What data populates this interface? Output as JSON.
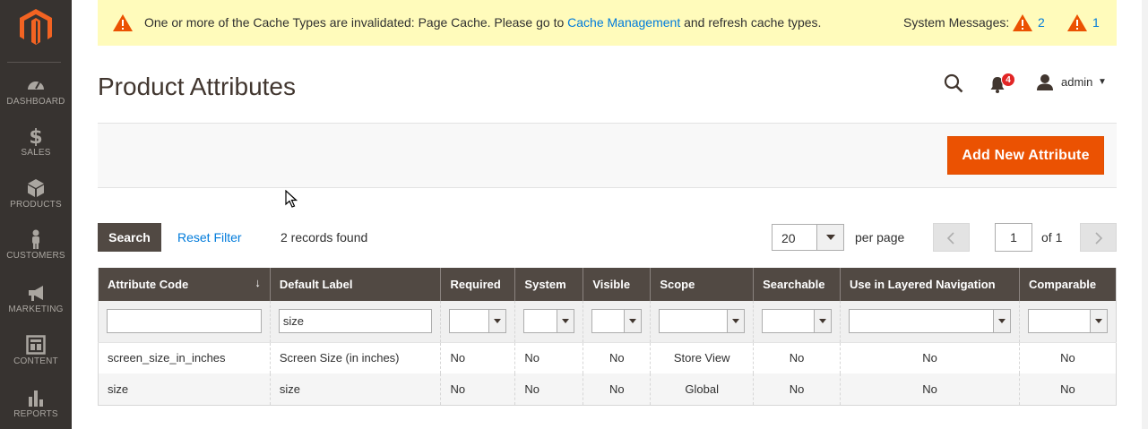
{
  "sidebar": {
    "items": [
      {
        "label": "DASHBOARD",
        "icon": "dashboard-icon"
      },
      {
        "label": "SALES",
        "icon": "dollar-icon"
      },
      {
        "label": "PRODUCTS",
        "icon": "cube-icon"
      },
      {
        "label": "CUSTOMERS",
        "icon": "person-icon"
      },
      {
        "label": "MARKETING",
        "icon": "megaphone-icon"
      },
      {
        "label": "CONTENT",
        "icon": "layout-icon"
      },
      {
        "label": "REPORTS",
        "icon": "bar-chart-icon"
      }
    ]
  },
  "message_bar": {
    "text_before": "One or more of the Cache Types are invalidated: Page Cache. Please go to ",
    "link": "Cache Management",
    "text_after": " and refresh cache types.",
    "system_label": "System Messages:",
    "count_critical": "2",
    "count_major": "1"
  },
  "header": {
    "title": "Product Attributes",
    "notification_count": "4",
    "user": "admin"
  },
  "actions": {
    "add_button": "Add New Attribute"
  },
  "grid_controls": {
    "search_button": "Search",
    "reset_filter": "Reset Filter",
    "records_found": "2 records found",
    "per_page_value": "20",
    "per_page_label": "per page",
    "page_current": "1",
    "page_total_label": "of 1"
  },
  "table": {
    "columns": [
      "Attribute Code",
      "Default Label",
      "Required",
      "System",
      "Visible",
      "Scope",
      "Searchable",
      "Use in Layered Navigation",
      "Comparable"
    ],
    "filters": {
      "attribute_code": "",
      "default_label": "size"
    },
    "rows": [
      {
        "code": "screen_size_in_inches",
        "label": "Screen Size (in inches)",
        "required": "No",
        "system": "No",
        "visible": "No",
        "scope": "Store View",
        "searchable": "No",
        "layered": "No",
        "comparable": "No"
      },
      {
        "code": "size",
        "label": "size",
        "required": "No",
        "system": "No",
        "visible": "No",
        "scope": "Global",
        "searchable": "No",
        "layered": "No",
        "comparable": "No"
      }
    ]
  },
  "colors": {
    "sidebar_bg": "#373330",
    "accent_orange": "#eb5202",
    "header_dark": "#514943",
    "link_blue": "#007bdb",
    "message_bg": "#fffbbb"
  }
}
